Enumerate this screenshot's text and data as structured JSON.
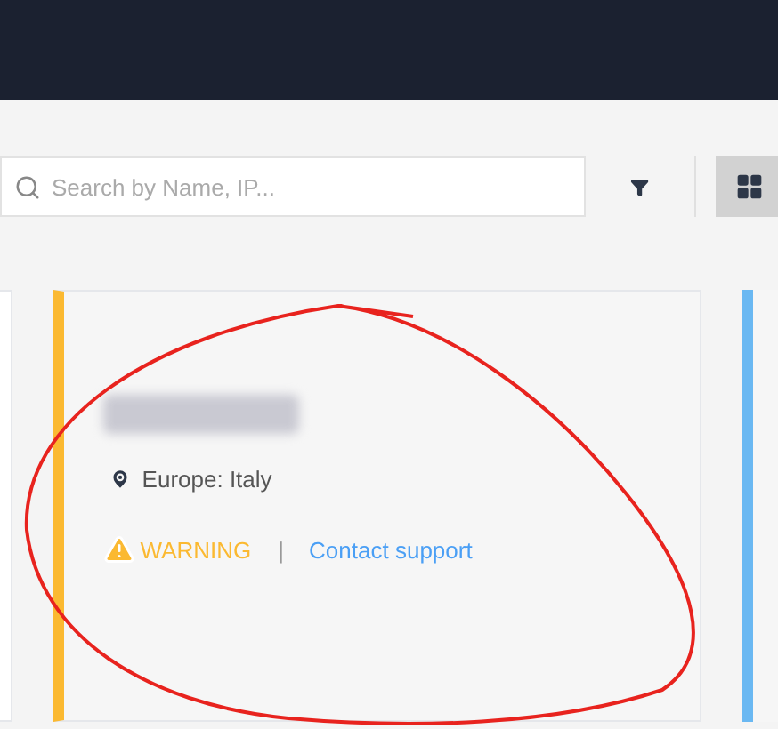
{
  "search": {
    "placeholder": "Search by Name, IP..."
  },
  "view_toggle": {
    "selected": true
  },
  "card": {
    "color": "#fbb931",
    "location": "Europe: Italy",
    "status": "WARNING",
    "separator": "|",
    "link": "Contact support"
  },
  "next_card": {
    "color": "#6ab8f2"
  }
}
